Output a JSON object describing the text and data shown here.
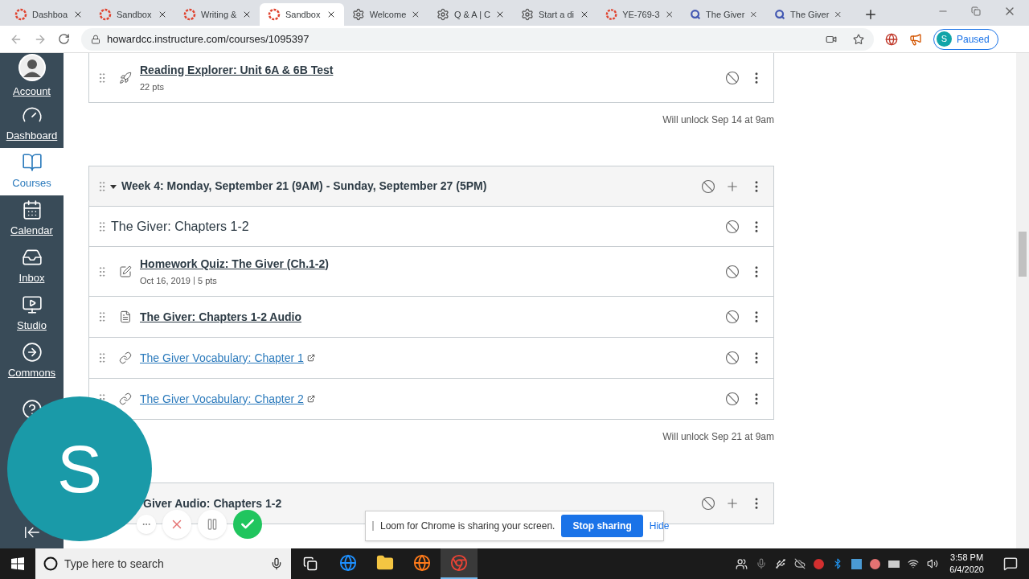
{
  "browser": {
    "tabs": [
      {
        "label": "Dashboa",
        "kind": "ring",
        "selected": false
      },
      {
        "label": "Sandbox",
        "kind": "ring",
        "selected": false
      },
      {
        "label": "Writing &",
        "kind": "ring",
        "selected": false
      },
      {
        "label": "Sandbox",
        "kind": "ring",
        "selected": true
      },
      {
        "label": "Welcome",
        "kind": "gear",
        "selected": false
      },
      {
        "label": "Q & A | C",
        "kind": "gear",
        "selected": false
      },
      {
        "label": "Start a di",
        "kind": "gear",
        "selected": false
      },
      {
        "label": "YE-769-3",
        "kind": "ring",
        "selected": false
      },
      {
        "label": "The Giver",
        "kind": "q",
        "selected": false
      },
      {
        "label": "The Giver",
        "kind": "q",
        "selected": false
      }
    ],
    "address": "howardcc.instructure.com/courses/1095397",
    "profile": {
      "initial": "S",
      "status": "Paused"
    }
  },
  "sidebar": {
    "items": [
      {
        "kind": "account",
        "label": "Account",
        "selected": false
      },
      {
        "kind": "dashboard",
        "label": "Dashboard",
        "selected": false
      },
      {
        "kind": "courses",
        "label": "Courses",
        "selected": true
      },
      {
        "kind": "calendar",
        "label": "Calendar",
        "selected": false
      },
      {
        "kind": "inbox",
        "label": "Inbox",
        "selected": false
      },
      {
        "kind": "studio",
        "label": "Studio",
        "selected": false
      },
      {
        "kind": "commons",
        "label": "Commons",
        "selected": false
      },
      {
        "kind": "help",
        "selected": false
      }
    ]
  },
  "content": {
    "top_item": {
      "kind": "assessment",
      "title": "Reading Explorer: Unit 6A & 6B Test",
      "meta": [
        "22 pts"
      ]
    },
    "top_unlock": "Will unlock Sep 14 at 9am",
    "module": {
      "title": "Week 4: Monday, September 21 (9AM) - Sunday, September 27 (5PM)",
      "expanded": true,
      "items": [
        {
          "kind": "subheader",
          "title": "The Giver: Chapters 1-2"
        },
        {
          "kind": "quiz",
          "title": "Homework Quiz: The Giver (Ch.1-2)",
          "meta": [
            "Oct 16, 2019",
            "5 pts"
          ]
        },
        {
          "kind": "page",
          "title": "The Giver: Chapters 1-2 Audio"
        },
        {
          "kind": "link",
          "title": "The Giver Vocabulary: Chapter 1"
        },
        {
          "kind": "link",
          "title": "The Giver Vocabulary: Chapter 2"
        }
      ],
      "unlock": "Will unlock Sep 21 at 9am"
    },
    "next_module": {
      "title": "Giver Audio: Chapters 1-2"
    }
  },
  "loom": {
    "initial": "S",
    "notice": "Loom for Chrome is sharing your screen.",
    "stop": "Stop sharing",
    "hide": "Hide"
  },
  "taskbar": {
    "search_placeholder": "Type here to search",
    "apps": [
      {
        "kind": "ie",
        "selected": false
      },
      {
        "kind": "folder",
        "selected": false
      },
      {
        "kind": "firefox",
        "selected": false
      },
      {
        "kind": "chrome",
        "selected": true
      }
    ],
    "time": "3:58 PM",
    "date": "6/4/2020"
  }
}
